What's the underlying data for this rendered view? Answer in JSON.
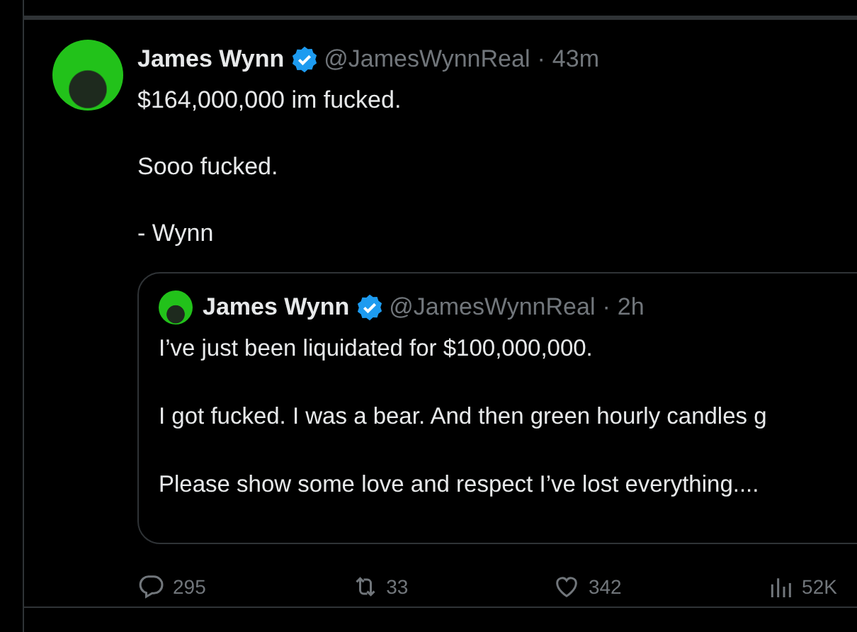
{
  "post": {
    "author": {
      "name": "James Wynn",
      "verified": true,
      "handle": "@JamesWynnReal",
      "separator": "·",
      "time": "43m"
    },
    "paragraphs": [
      "$164,000,000 im fucked.",
      "Sooo fucked.",
      "- Wynn"
    ],
    "quote": {
      "author": {
        "name": "James Wynn",
        "verified": true,
        "handle": "@JamesWynnReal",
        "separator": "·",
        "time": "2h"
      },
      "paragraphs": [
        "I’ve just been liquidated for $100,000,000.",
        "I got fucked. I was a bear. And then green hourly candles g",
        "Please show some love and respect I’ve lost everything...."
      ]
    },
    "actions": [
      {
        "kind": "reply",
        "count": "295"
      },
      {
        "kind": "repost",
        "count": "33"
      },
      {
        "kind": "like",
        "count": "342"
      },
      {
        "kind": "views",
        "count": "52K"
      }
    ]
  }
}
